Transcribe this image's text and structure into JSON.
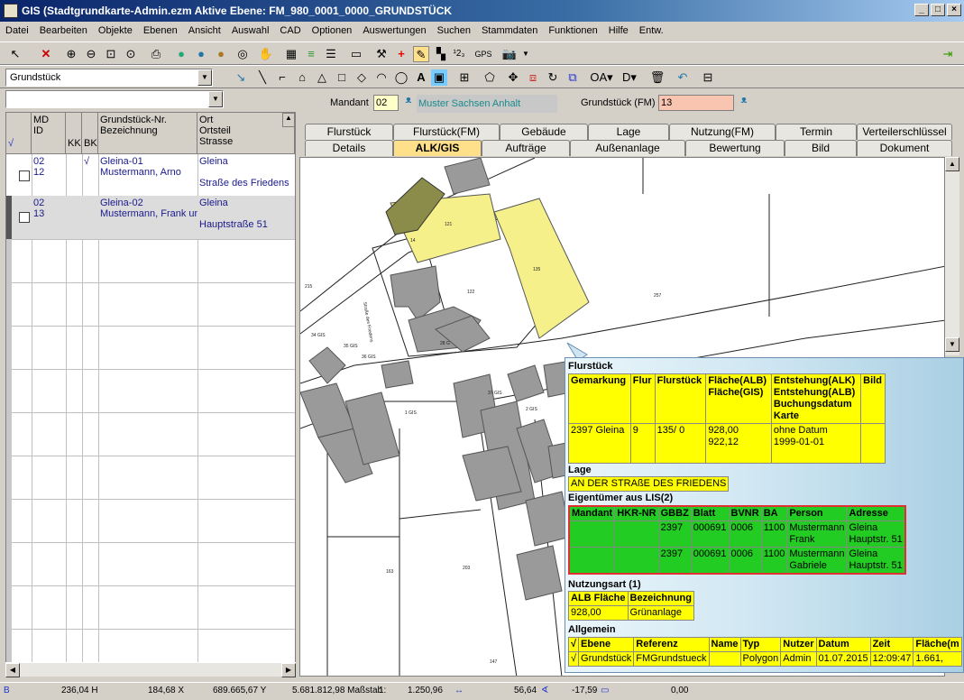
{
  "window": {
    "title": "GIS (Stadtgrundkarte-Admin.ezm Aktive Ebene: FM_980_0001_0000_GRUNDSTÜCK",
    "min": "_",
    "max": "□",
    "close": "×"
  },
  "menu": [
    "Datei",
    "Bearbeiten",
    "Objekte",
    "Ebenen",
    "Ansicht",
    "Auswahl",
    "CAD",
    "Optionen",
    "Auswertungen",
    "Suchen",
    "Stammdaten",
    "Funktionen",
    "Hilfe",
    "Entw."
  ],
  "toolbar": {
    "layer_combo": "Grundstück",
    "gps_label": "GPS",
    "sup_label": "¹2₃"
  },
  "filter_combo": "",
  "grid": {
    "headers": {
      "check": "√",
      "md_id": "MD\nID",
      "kk": "KK",
      "bk": "BK",
      "nr": "Grundstück-Nr.\nBezeichnung",
      "ort": "Ort\nOrtsteil\nStrasse"
    },
    "rows": [
      {
        "md": "02",
        "id": "12",
        "bk": "√",
        "nr": "Gleina-01",
        "bez": "Mustermann, Arno",
        "ort": "Gleina",
        "str": "Straße des Friedens"
      },
      {
        "md": "02",
        "id": "13",
        "bk": "",
        "nr": "Gleina-02",
        "bez": "Mustermann, Frank und",
        "ort": "Gleina",
        "str": "Hauptstraße 51"
      }
    ]
  },
  "mandant": {
    "label": "Mandant",
    "code": "02",
    "name": "Muster Sachsen Anhalt",
    "grundstueck_label": "Grundstück (FM)",
    "grundstueck_value": "13"
  },
  "tabs_row1": [
    "Flurstück",
    "Flurstück(FM)",
    "Gebäude",
    "Lage",
    "Nutzung(FM)",
    "Termin",
    "Verteilerschlüssel"
  ],
  "tabs_row2": [
    "Details",
    "ALK/GIS",
    "Aufträge",
    "Außenanlage",
    "Bewertung",
    "Bild",
    "Dokument"
  ],
  "active_tab": "ALK/GIS",
  "map_labels": {
    "parcel_121": "121",
    "parcel_135": "135",
    "parcel_122": "122",
    "parcel_257": "257",
    "street": "Straße des Friedens",
    "parcel_215": "215",
    "parcel_14": "14",
    "parcel_163": "163",
    "parcel_203": "203",
    "parcel_147": "147",
    "parcel_28": "28 G",
    "label_34gis": "34 GIS",
    "label_35gis": "35 GIS",
    "label_36gis": "36 GIS",
    "label_37gis": "37 GIS",
    "label_gis1": "1 GIS",
    "label_gis2": "2 GIS"
  },
  "popup": {
    "flurstueck_title": "Flurstück",
    "flurstueck_headers": [
      "Gemarkung",
      "Flur",
      "Flurstück",
      "Fläche(ALB)\nFläche(GIS)",
      "Entstehung(ALK)\nEntstehung(ALB)\nBuchungsdatum\nKarte",
      "Bild"
    ],
    "flurstueck_row": [
      "2397 Gleina",
      "9",
      "135/ 0",
      "928,00\n922,12",
      "ohne Datum\n1999-01-01",
      ""
    ],
    "lage_title": "Lage",
    "lage_value": "AN DER STRAßE DES FRIEDENS",
    "eigentuemer_title": "Eigentümer aus LIS(2)",
    "eigentuemer_headers": [
      "Mandant",
      "HKR-NR",
      "GBBZ",
      "Blatt",
      "BVNR",
      "BA",
      "Person",
      "Adresse"
    ],
    "eigentuemer_rows": [
      [
        "",
        "",
        "2397",
        "000691",
        "0006",
        "1100",
        "Mustermann\nFrank",
        "Gleina\nHauptstr. 51"
      ],
      [
        "",
        "",
        "2397",
        "000691",
        "0006",
        "1100",
        "Mustermann\nGabriele",
        "Gleina\nHauptstr. 51"
      ]
    ],
    "nutzung_title": "Nutzungsart (1)",
    "nutzung_headers": [
      "ALB Fläche",
      "Bezeichnung"
    ],
    "nutzung_row": [
      "928,00",
      "Grünanlage"
    ],
    "allgemein_title": "Allgemein",
    "allgemein_headers": [
      "√",
      "Ebene",
      "Referenz",
      "Name",
      "Typ",
      "Nutzer",
      "Datum",
      "Zeit",
      "Fläche(m"
    ],
    "allgemein_row": [
      "√",
      "Grundstück",
      "FMGrundstueck",
      "",
      "Polygon",
      "Admin",
      "01.07.2015",
      "12:09:47",
      "1.661,"
    ]
  },
  "status": {
    "b": "B",
    "h": "236,04 H",
    "x": "184,68 X",
    "y": "689.665,67 Y",
    "mass": "5.681.812,98 Maßstab",
    "scale_pre": "1:",
    "scale": "1.250,96",
    "angle": "56,64",
    "neg": "-17,59",
    "zero": "0,00"
  },
  "colors": {
    "parcel_yellow": "#f5f08a",
    "building_gray": "#9a9a9a",
    "selected_olive": "#8b8b4a",
    "owner_green": "#22cc22",
    "table_yellow": "#ffff00"
  }
}
